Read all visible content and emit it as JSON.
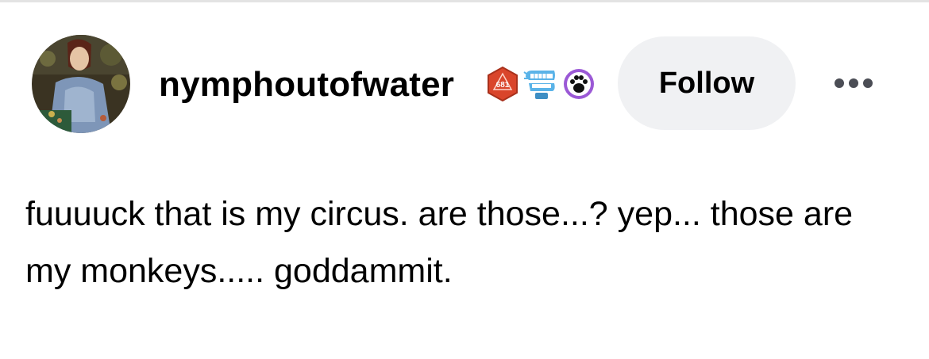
{
  "post": {
    "username": "nymphoutofwater",
    "follow_label": "Follow",
    "body_text": "fuuuuck that is my circus. are those...? yep... those are my monkeys..... goddammit.",
    "badges": [
      {
        "icon": "d20-dice-badge-icon",
        "text": "681",
        "color": "#d9452b"
      },
      {
        "icon": "chattering-teeth-badge-icon",
        "color": "#5ab3e8"
      },
      {
        "icon": "paw-print-badge-icon",
        "color": "#9b59d6"
      }
    ]
  },
  "colors": {
    "follow_bg": "#f0f1f3",
    "more_dots": "#4b4d55",
    "top_border": "#e3e3e3"
  }
}
